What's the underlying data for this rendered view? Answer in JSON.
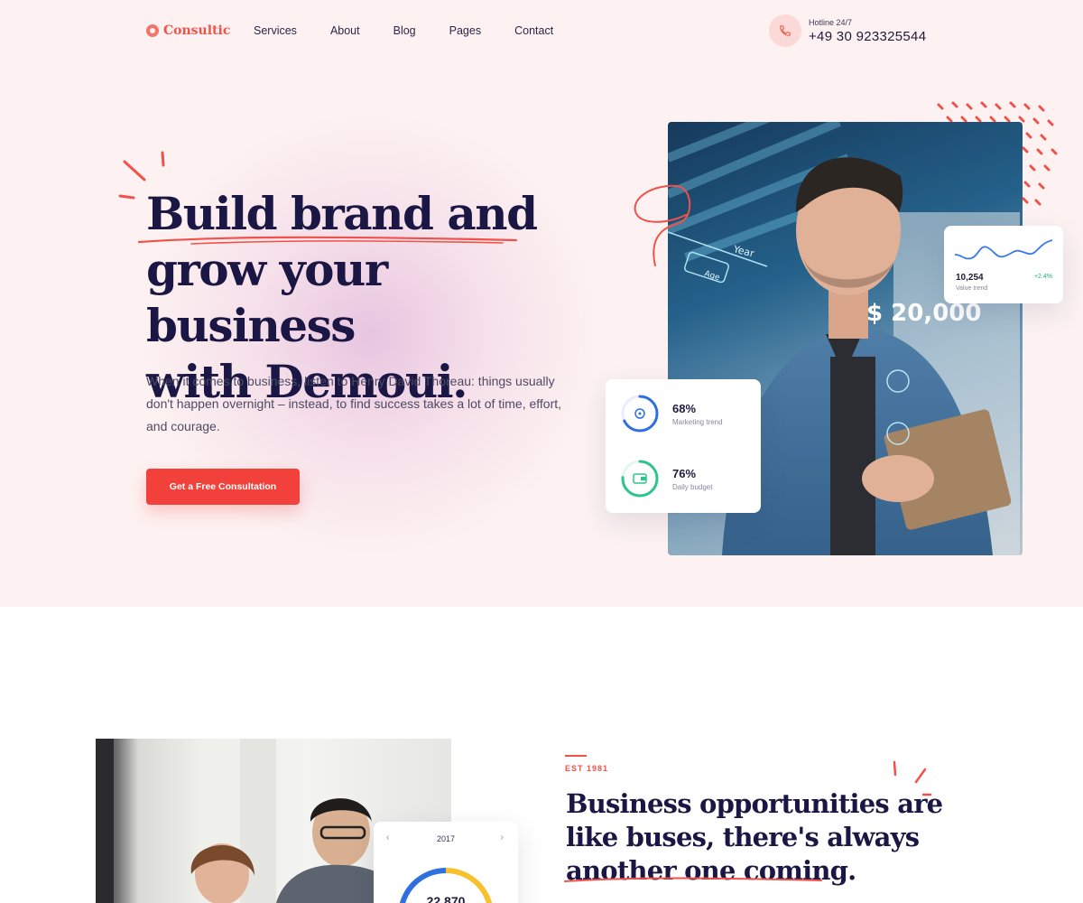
{
  "brand": {
    "name": "Consultic",
    "accent": "#f2403a"
  },
  "nav": {
    "items": [
      "Services",
      "About",
      "Blog",
      "Pages",
      "Contact"
    ]
  },
  "hotline": {
    "label": "Hotline 24/7",
    "number": "+49 30 923325544",
    "icon": "phone-icon"
  },
  "hero": {
    "title_lines": [
      "Build brand and",
      "grow your business",
      "with Demoui."
    ],
    "description": "When it comes to business, listen to Henry David Thoreau: things usually don't happen overnight – instead, to find success takes a lot of time, effort, and courage.",
    "cta_label": "Get a Free Consultation",
    "photo_overlay": {
      "amount": "$ 20,000",
      "year": "Year",
      "tag": "Age"
    },
    "stats": [
      {
        "value": "68%",
        "label": "Marketing trend",
        "progress": 0.68,
        "color": "#2f6fe0",
        "icon": "target-icon"
      },
      {
        "value": "76%",
        "label": "Daily budget",
        "progress": 0.76,
        "color": "#2dc58c",
        "icon": "wallet-icon"
      }
    ],
    "value_card": {
      "value": "10,254",
      "label": "Value trend",
      "change": "+2.4%",
      "line_color": "#3a78f2"
    }
  },
  "section2": {
    "eyebrow": "EST 1981",
    "title_lines": [
      "Business opportunities are",
      "like buses, there's always",
      "another one coming."
    ],
    "card": {
      "year": "2017",
      "value": "22,870",
      "prev_icon": "chevron-left-icon",
      "next_icon": "chevron-right-icon"
    }
  }
}
